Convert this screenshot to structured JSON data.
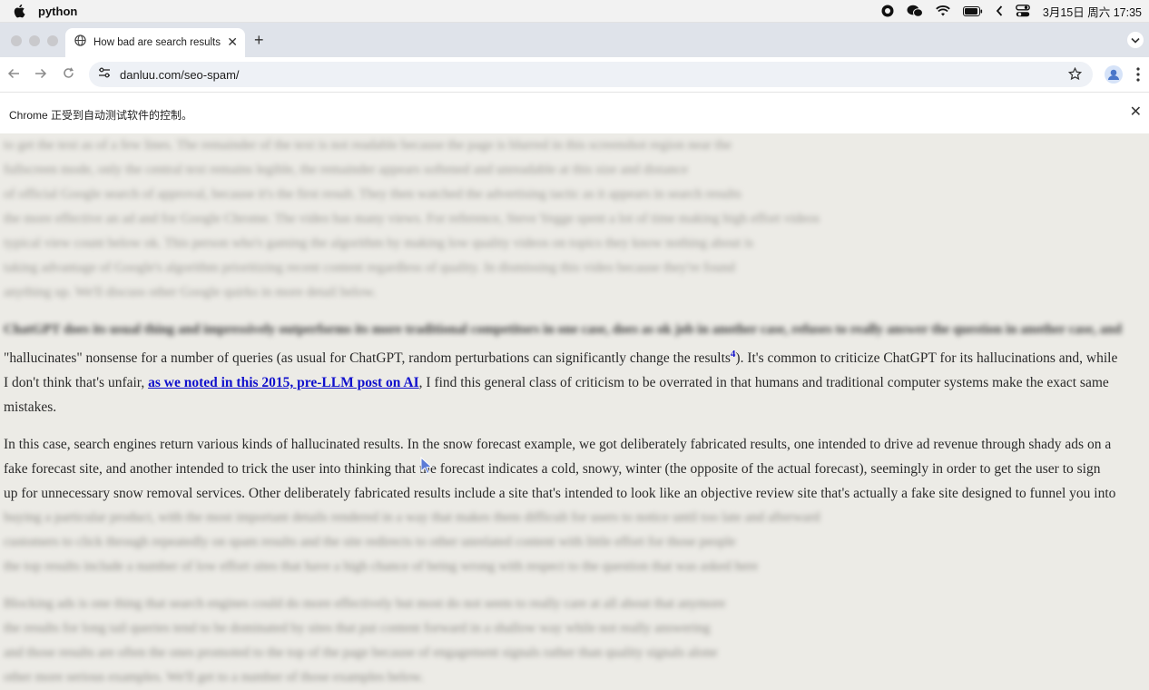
{
  "menubar": {
    "app_name": "python",
    "clock": "3月15日 周六 17:35"
  },
  "tab": {
    "title": "How bad are search results? |"
  },
  "toolbar": {
    "url": "danluu.com/seo-spam/"
  },
  "infobar": {
    "message": "Chrome 正受到自动测试软件的控制。"
  },
  "content": {
    "blurred_top": [
      "to get the text as of a few lines. The remainder of the text is not readable because the page is blurred in this screenshot region near the",
      "fullscreen mode, only the central text remains legible, the remainder appears softened and unreadable at this size and distance",
      "of official Google search of approval, because it's the first result. They then watched the advertising tactic as it appears in search results",
      "the more effective an ad and for Google Chrome. The video has many views. For reference, Steve Yegge spent a lot of time making high effort videos",
      "typical view count below ok. This person who's gaming the algorithm by making low quality videos on topics they know nothing about is",
      "taking advantage of Google's algorithm prioritizing recent content regardless of quality. In dismissing this video because they're found",
      "anything up. We'll discuss other Google quirks in more detail below."
    ],
    "blurred_lead": "ChatGPT does its usual thing and impressively outperforms its more traditional competitors in one case, does as ok job in another case, refuses to really answer the question in another case, and",
    "p1_line1": "\"hallucinates\" nonsense for a number of queries (as usual for ChatGPT, random perturbations can significantly change the results",
    "p1_footnote": "4",
    "p1_line1_tail": "). It's common to criticize ChatGPT for its hallucinations and, while",
    "p1_line2_pre": "I don't think that's unfair, ",
    "p1_link": "as we noted in this 2015, pre-LLM post on AI",
    "p1_line2_post": ", I find this general class of criticism to be overrated in that humans and traditional computer systems make the exact same",
    "p1_line3": "mistakes.",
    "p2_line1": "In this case, search engines return various kinds of hallucinated results. In the snow forecast example, we got deliberately fabricated results, one intended to drive ad revenue through shady ads on a",
    "p2_line2": "fake forecast site, and another intended to trick the user into thinking that the forecast indicates a cold, snowy, winter (the opposite of the actual forecast), seemingly in order to get the user to sign",
    "p2_line3": "up for unnecessary snow removal services. Other deliberately fabricated results include a site that's intended to look like an objective review site that's actually a fake site designed to funnel you into",
    "blurred_bottom": [
      "buying a particular product, with the most important details rendered in a way that makes them difficult for users to notice until too late and afterward",
      "customers to click through repeatedly on spam results and the site redirects to other unrelated content with little effort for those people",
      "the top results include a number of low effort sites that have a high chance of being wrong with respect to the question that was asked here",
      "Blocking ads is one thing that search engines could do more effectively but most do not seem to really care at all about that anymore",
      "the results for long tail queries tend to be dominated by sites that put content forward in a shallow way while not really answering",
      "and those results are often the ones promoted to the top of the page because of engagement signals rather than quality signals alone",
      "other more serious examples. We'll get to a number of those examples below."
    ]
  }
}
